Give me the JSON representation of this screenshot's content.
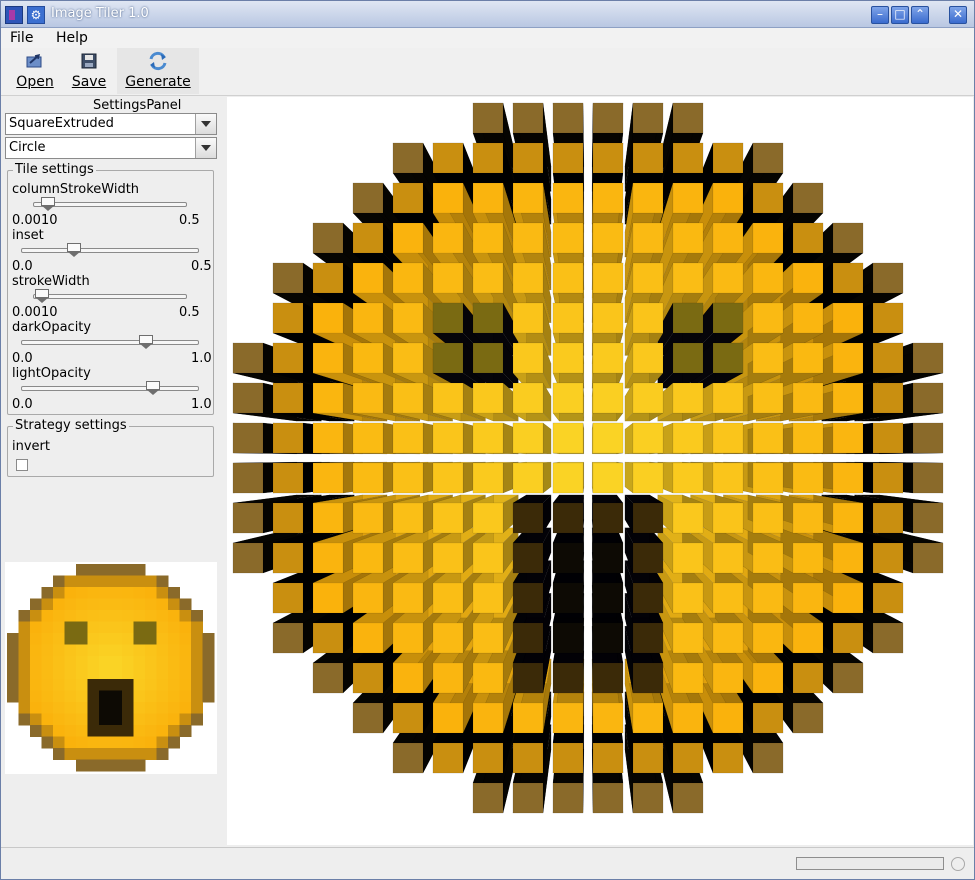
{
  "window": {
    "title": "Image Tiler 1.0"
  },
  "menu": {
    "file": "File",
    "help": "Help"
  },
  "toolbar": {
    "open": "Open",
    "save": "Save",
    "generate": "Generate"
  },
  "settings": {
    "panel_title": "SettingsPanel",
    "tile_style": "SquareExtruded",
    "shape": "Circle",
    "tile_settings": {
      "legend": "Tile settings",
      "params": [
        {
          "name": "columnStrokeWidth",
          "min": "0.0010",
          "max": "0.5",
          "value": 0.05
        },
        {
          "name": "inset",
          "min": "0.0",
          "max": "0.5",
          "value": 0.15
        },
        {
          "name": "strokeWidth",
          "min": "0.0010",
          "max": "0.5",
          "value": 0.03
        },
        {
          "name": "darkOpacity",
          "min": "0.0",
          "max": "1.0",
          "value": 0.7
        },
        {
          "name": "lightOpacity",
          "min": "0.0",
          "max": "1.0",
          "value": 0.74
        }
      ]
    },
    "strategy_settings": {
      "legend": "Strategy settings",
      "invert_label": "invert",
      "invert_checked": false
    }
  },
  "colors": {
    "accent": "#3a6bce",
    "face": "#f2c200",
    "dark": "#1a1206"
  }
}
